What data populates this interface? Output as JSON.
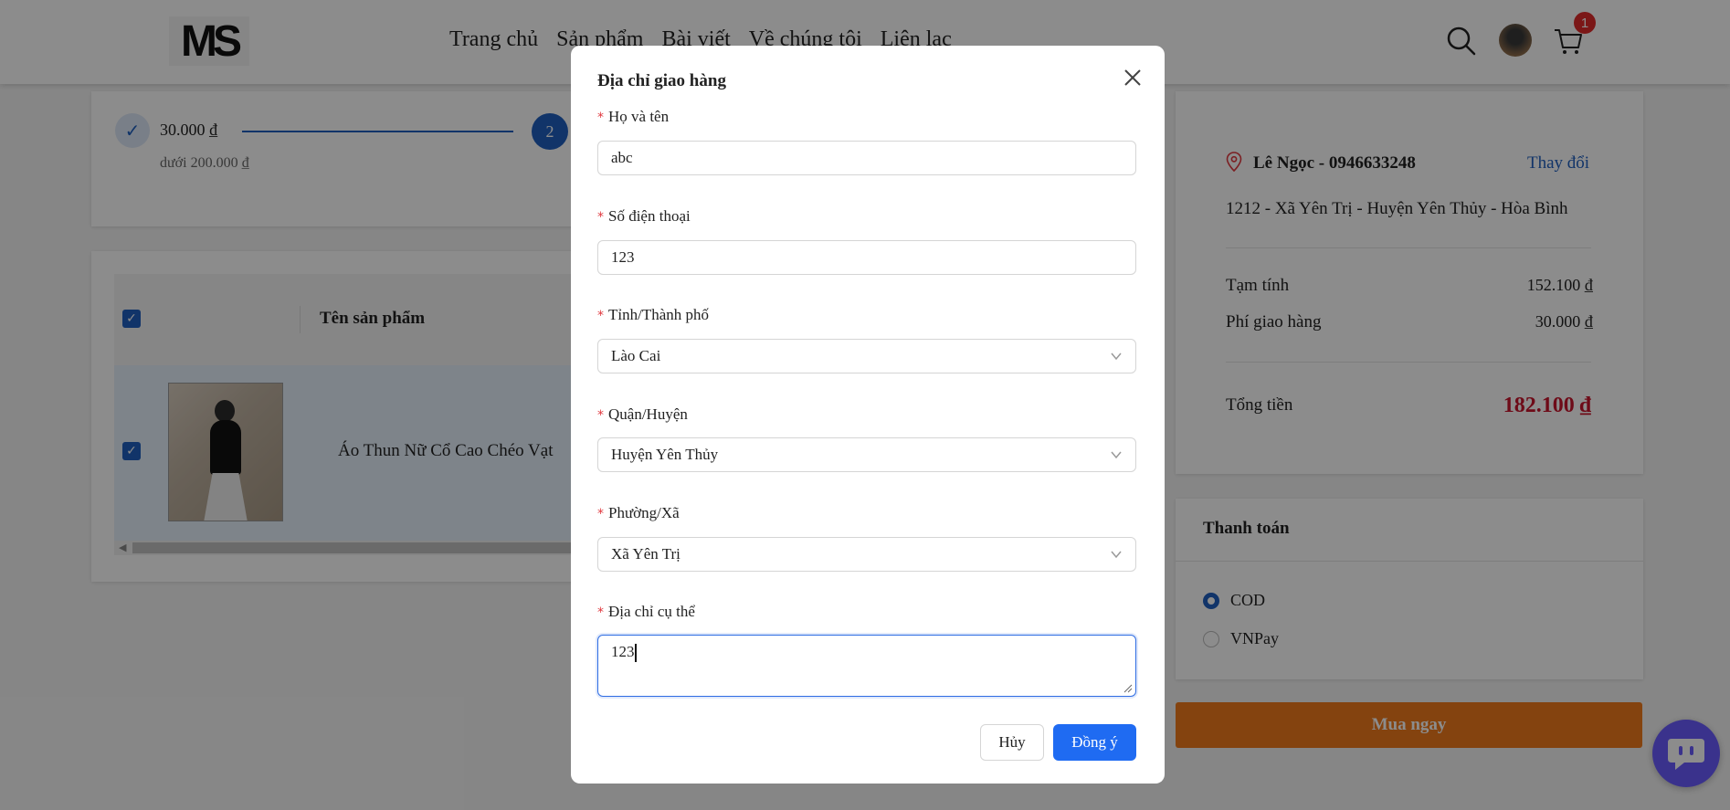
{
  "header": {
    "logo": "MS",
    "nav": [
      "Trang chủ",
      "Sản phẩm",
      "Bài viết",
      "Về chúng tôi",
      "Liên lạc"
    ],
    "cart_count": "1",
    "icons": {
      "search": "search-icon",
      "avatar": "avatar",
      "cart": "cart-icon"
    }
  },
  "progress": {
    "step1_amount": "30.000 ₫",
    "step1_sub": "dưới 200.000 ₫",
    "step2_label": "2"
  },
  "products": {
    "column_name": "Tên sản phẩm",
    "items": [
      {
        "name": "Áo Thun Nữ Cổ Cao Chéo Vạt"
      }
    ]
  },
  "address": {
    "recipient": "Lê Ngọc - 0946633248",
    "change_label": "Thay đổi",
    "line": "1212 - Xã Yên Trị - Huyện Yên Thủy - Hòa Bình"
  },
  "summary": {
    "subtotal_label": "Tạm tính",
    "subtotal_value": "152.100 ₫",
    "shipping_label": "Phí giao hàng",
    "shipping_value": "30.000 ₫",
    "total_label": "Tổng tiền",
    "total_value": "182.100 ₫"
  },
  "payment": {
    "title": "Thanh toán",
    "options": [
      {
        "label": "COD",
        "selected": true
      },
      {
        "label": "VNPay",
        "selected": false
      }
    ]
  },
  "buy_label": "Mua ngay",
  "modal": {
    "title": "Địa chỉ giao hàng",
    "fields": {
      "name": {
        "label": "Họ và tên",
        "value": "abc"
      },
      "phone": {
        "label": "Số điện thoại",
        "value": "123"
      },
      "province": {
        "label": "Tỉnh/Thành phố",
        "value": "Lào Cai"
      },
      "district": {
        "label": "Quận/Huyện",
        "value": "Huyện Yên Thủy"
      },
      "ward": {
        "label": "Phường/Xã",
        "value": "Xã Yên Trị"
      },
      "detail": {
        "label": "Địa chỉ cụ thể",
        "value": "123"
      }
    },
    "required_mark": "*",
    "cancel_label": "Hủy",
    "ok_label": "Đồng ý"
  },
  "colors": {
    "primary": "#1f6bf2",
    "total": "#c9152d",
    "buy": "#f07a1c",
    "chat": "#6b5cff",
    "badge": "#e02b2b"
  }
}
